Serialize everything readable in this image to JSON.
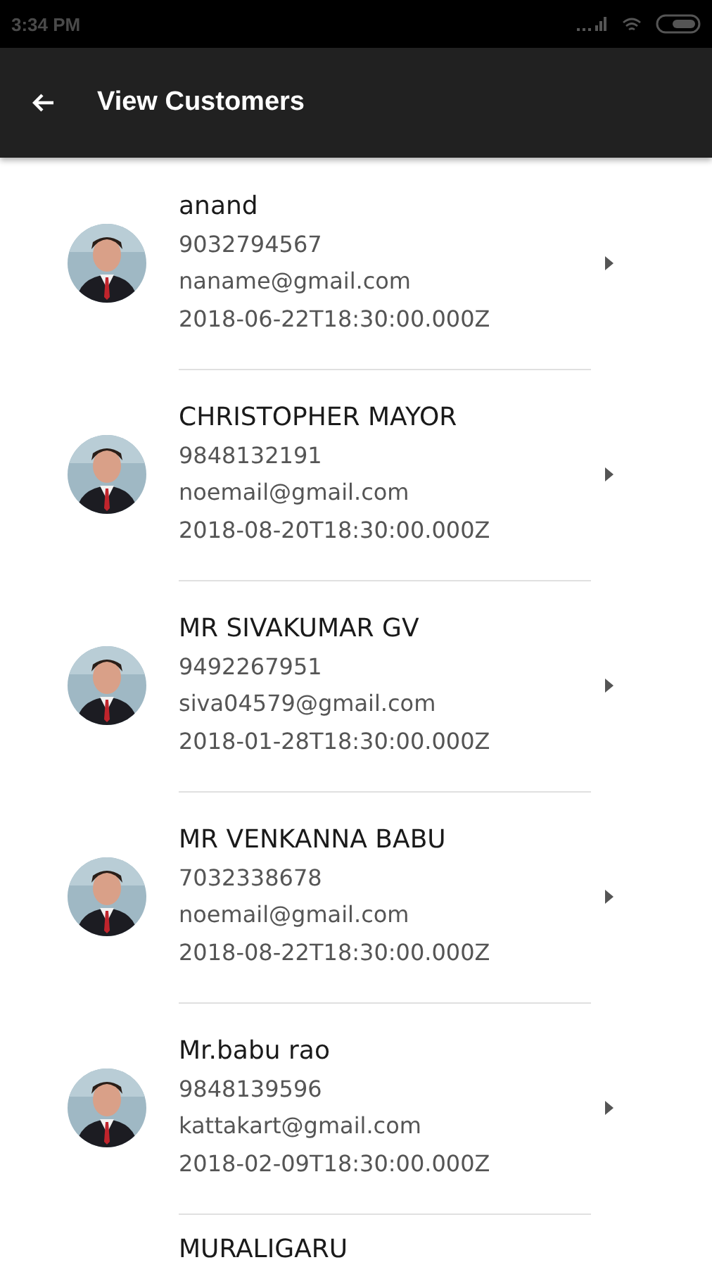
{
  "status_bar": {
    "time": "3:34 PM"
  },
  "app_bar": {
    "title": "View Customers"
  },
  "customers": [
    {
      "name": "anand",
      "phone": "9032794567",
      "email": "naname@gmail.com",
      "date": "2018-06-22T18:30:00.000Z"
    },
    {
      "name": "CHRISTOPHER MAYOR",
      "phone": "9848132191",
      "email": "noemail@gmail.com",
      "date": "2018-08-20T18:30:00.000Z"
    },
    {
      "name": "MR SIVAKUMAR GV",
      "phone": "9492267951",
      "email": "siva04579@gmail.com",
      "date": "2018-01-28T18:30:00.000Z"
    },
    {
      "name": "MR VENKANNA BABU",
      "phone": "7032338678",
      "email": "noemail@gmail.com",
      "date": "2018-08-22T18:30:00.000Z"
    },
    {
      "name": "Mr.babu rao",
      "phone": "9848139596",
      "email": "kattakart@gmail.com",
      "date": "2018-02-09T18:30:00.000Z"
    },
    {
      "name": "MURALIGARU"
    }
  ]
}
